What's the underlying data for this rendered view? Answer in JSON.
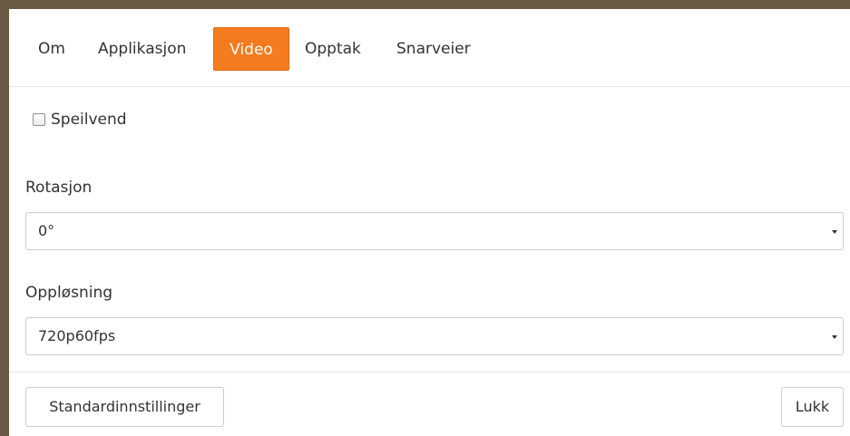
{
  "tabs": [
    {
      "label": "Om",
      "active": false
    },
    {
      "label": "Applikasjon",
      "active": false
    },
    {
      "label": "Video",
      "active": true
    },
    {
      "label": "Opptak",
      "active": false
    },
    {
      "label": "Snarveier",
      "active": false
    }
  ],
  "mirror": {
    "label": "Speilvend",
    "checked": false
  },
  "rotation": {
    "label": "Rotasjon",
    "value": "0°"
  },
  "resolution": {
    "label": "Oppløsning",
    "value": "720p60fps"
  },
  "footer": {
    "defaults_label": "Standardinnstillinger",
    "close_label": "Lukk"
  },
  "colors": {
    "accent": "#f47b20",
    "backdrop": "#6b5a45"
  }
}
